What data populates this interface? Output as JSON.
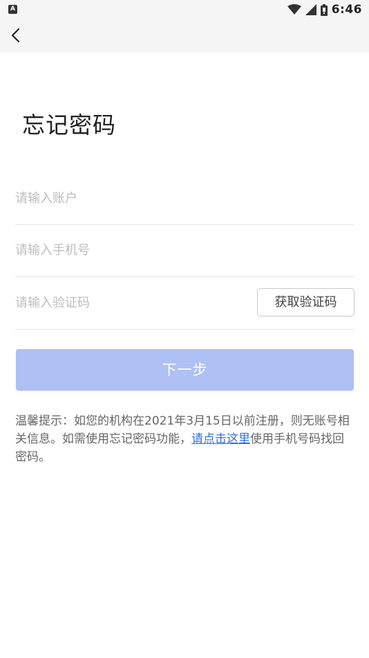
{
  "status_bar": {
    "notification_icon_text": "A",
    "time": "6:46",
    "icons": [
      "wifi-icon",
      "cellular-signal-icon",
      "battery-icon"
    ]
  },
  "header": {
    "back_icon": "chevron-left-icon"
  },
  "page": {
    "title": "忘记密码"
  },
  "form": {
    "account": {
      "placeholder": "请输入账户",
      "value": ""
    },
    "phone": {
      "placeholder": "请输入手机号",
      "value": ""
    },
    "code": {
      "placeholder": "请输入验证码",
      "value": ""
    },
    "get_code_label": "获取验证码",
    "next_label": "下一步"
  },
  "tip": {
    "text_before": "温馨提示：如您的机构在2021年3月15日以前注册，则无账号相关信息。如需使用忘记密码功能，",
    "link_text": "请点击这里",
    "text_after": "使用手机号码找回密码。"
  },
  "colors": {
    "top_area_bg": "#f5f5f5",
    "next_button_bg": "#aec0f4",
    "link": "#2f6fe4",
    "divider": "#e6e6e6",
    "placeholder": "#bdbdbd"
  }
}
